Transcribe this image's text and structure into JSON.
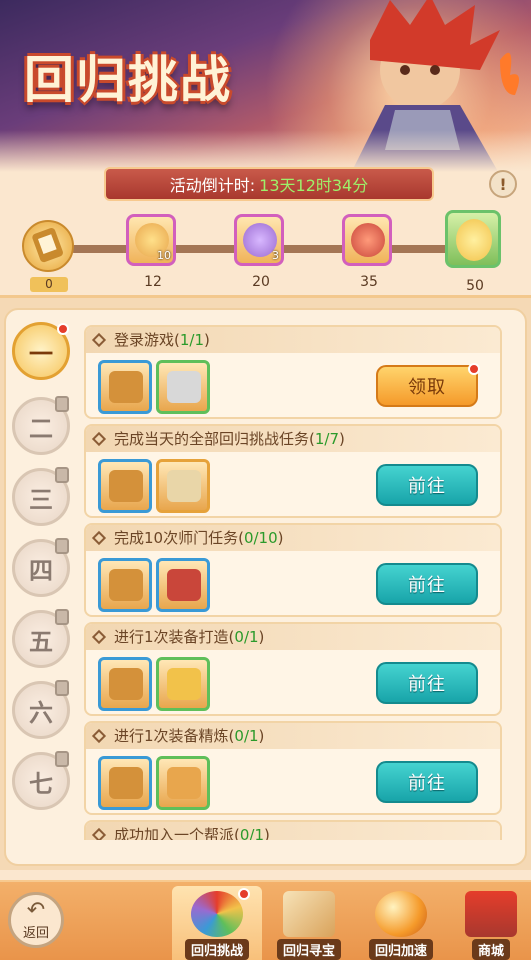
{
  "banner": {
    "title": "回归挑战"
  },
  "countdown": {
    "label": "活动倒计时:",
    "value": "13天12时34分"
  },
  "help_icon": "!",
  "progress": {
    "start_value": "0",
    "milestones": [
      {
        "value": "12",
        "count": "10",
        "icon": "gold-bag-icon",
        "color": "#e8a64d"
      },
      {
        "value": "20",
        "count": "3",
        "icon": "purple-pouch-icon",
        "color": "#9a6ad0"
      },
      {
        "value": "35",
        "count": "",
        "icon": "red-bag-icon",
        "color": "#c9463a"
      },
      {
        "value": "50",
        "count": "",
        "icon": "golden-egg-icon",
        "color": "#f2c24a"
      }
    ]
  },
  "tabs": [
    {
      "label": "一",
      "state": "active"
    },
    {
      "label": "二",
      "state": "locked"
    },
    {
      "label": "三",
      "state": "locked"
    },
    {
      "label": "四",
      "state": "locked"
    },
    {
      "label": "五",
      "state": "locked"
    },
    {
      "label": "六",
      "state": "locked"
    },
    {
      "label": "七",
      "state": "locked"
    }
  ],
  "tasks": [
    {
      "name": "登录游戏(",
      "progress": "1/1",
      "close": ")",
      "button": "领取",
      "button_type": "claim"
    },
    {
      "name": "完成当天的全部回归挑战任务(",
      "progress": "1/7",
      "close": ")",
      "button": "前往",
      "button_type": "go"
    },
    {
      "name": "完成10次师门任务(",
      "progress": "0/10",
      "close": ")",
      "button": "前往",
      "button_type": "go"
    },
    {
      "name": "进行1次装备打造(",
      "progress": "0/1",
      "close": ")",
      "button": "前往",
      "button_type": "go"
    },
    {
      "name": "进行1次装备精炼(",
      "progress": "0/1",
      "close": ")",
      "button": "前往",
      "button_type": "go"
    },
    {
      "name": "成功加入一个帮派(",
      "progress": "0/1",
      "close": ")",
      "button": "",
      "button_type": "go"
    }
  ],
  "bottom_nav": {
    "back_label": "返回",
    "items": [
      {
        "label": "回归挑战",
        "icon": "wheel-icon"
      },
      {
        "label": "回归寻宝",
        "icon": "scroll-map-icon"
      },
      {
        "label": "回归加速",
        "icon": "orb-icon"
      },
      {
        "label": "商城",
        "icon": "shop-icon"
      }
    ]
  },
  "colors": {
    "accent_green": "#9ef06a",
    "go_button": "#18a4a9",
    "claim_button": "#f59a2a",
    "badge_red": "#e53d2b"
  }
}
